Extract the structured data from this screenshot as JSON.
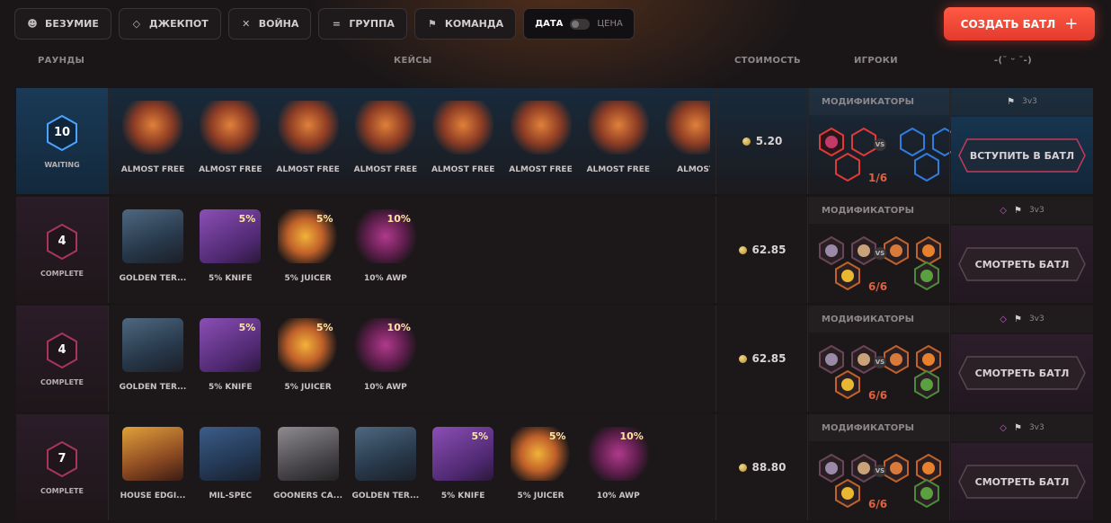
{
  "filters": [
    {
      "label": "БЕЗУМИЕ",
      "icon": "smiley-icon"
    },
    {
      "label": "ДЖЕКПОТ",
      "icon": "diamond-icon"
    },
    {
      "label": "ВОЙНА",
      "icon": "swords-icon"
    },
    {
      "label": "ГРУППА",
      "icon": "equals-icon"
    },
    {
      "label": "КОМАНДА",
      "icon": "flag-icon"
    }
  ],
  "sort": {
    "active": "ДАТА",
    "inactive": "ЦЕНА"
  },
  "create_button": {
    "label": "СОЗДАТЬ БАТЛ",
    "icon": "+"
  },
  "headers": {
    "rounds": "РАУНДЫ",
    "cases": "КЕЙСЫ",
    "cost": "СТОИМОСТЬ",
    "players": "ИГРОКИ",
    "extra": "-(˘ ᵕ ˘-)"
  },
  "colors": {
    "accent": "#ff4b3a",
    "waiting": "#1a3a57",
    "complete": "#2b1c28",
    "team_red": "#e0393a",
    "team_blue": "#2f7de1"
  },
  "battles": [
    {
      "rounds": "10",
      "status": "WAITING",
      "state": "waiting",
      "cases": [
        {
          "name": "ALMOST FREE",
          "art": "free",
          "tag": ""
        },
        {
          "name": "ALMOST FREE",
          "art": "free",
          "tag": ""
        },
        {
          "name": "ALMOST FREE",
          "art": "free",
          "tag": ""
        },
        {
          "name": "ALMOST FREE",
          "art": "free",
          "tag": ""
        },
        {
          "name": "ALMOST FREE",
          "art": "free",
          "tag": ""
        },
        {
          "name": "ALMOST FREE",
          "art": "free",
          "tag": ""
        },
        {
          "name": "ALMOST FREE",
          "art": "free",
          "tag": ""
        },
        {
          "name": "ALMOST",
          "art": "free",
          "tag": ""
        }
      ],
      "cost": "5.20",
      "modifiers_label": "МОДИФИКАТОРЫ",
      "mode": "3v3",
      "mode_gem": false,
      "players_count": "1/6",
      "action": "ВСТУПИТЬ В БАТЛ"
    },
    {
      "rounds": "4",
      "status": "COMPLETE",
      "state": "complete",
      "cases": [
        {
          "name": "GOLDEN TER...",
          "art": "golden",
          "tag": ""
        },
        {
          "name": "5% KNIFE",
          "art": "knife",
          "tag": "5%"
        },
        {
          "name": "5% JUICER",
          "art": "juicer",
          "tag": "5%"
        },
        {
          "name": "10% AWP",
          "art": "awp",
          "tag": "10%"
        }
      ],
      "cost": "62.85",
      "modifiers_label": "МОДИФИКАТОРЫ",
      "mode": "3v3",
      "mode_gem": true,
      "players_count": "6/6",
      "action": "СМОТРЕТЬ БАТЛ"
    },
    {
      "rounds": "4",
      "status": "COMPLETE",
      "state": "complete",
      "cases": [
        {
          "name": "GOLDEN TER...",
          "art": "golden",
          "tag": ""
        },
        {
          "name": "5% KNIFE",
          "art": "knife",
          "tag": "5%"
        },
        {
          "name": "5% JUICER",
          "art": "juicer",
          "tag": "5%"
        },
        {
          "name": "10% AWP",
          "art": "awp",
          "tag": "10%"
        }
      ],
      "cost": "62.85",
      "modifiers_label": "МОДИФИКАТОРЫ",
      "mode": "3v3",
      "mode_gem": true,
      "players_count": "6/6",
      "action": "СМОТРЕТЬ БАТЛ"
    },
    {
      "rounds": "7",
      "status": "COMPLETE",
      "state": "complete",
      "cases": [
        {
          "name": "HOUSE EDGI...",
          "art": "house",
          "tag": ""
        },
        {
          "name": "MIL-SPEC",
          "art": "milspec",
          "tag": ""
        },
        {
          "name": "GOONERS CA...",
          "art": "gooners",
          "tag": ""
        },
        {
          "name": "GOLDEN TER...",
          "art": "golden",
          "tag": ""
        },
        {
          "name": "5% KNIFE",
          "art": "knife",
          "tag": "5%"
        },
        {
          "name": "5% JUICER",
          "art": "juicer",
          "tag": "5%"
        },
        {
          "name": "10% AWP",
          "art": "awp",
          "tag": "10%"
        }
      ],
      "cost": "88.80",
      "modifiers_label": "МОДИФИКАТОРЫ",
      "mode": "3v3",
      "mode_gem": true,
      "players_count": "6/6",
      "action": "СМОТРЕТЬ БАТЛ"
    }
  ]
}
